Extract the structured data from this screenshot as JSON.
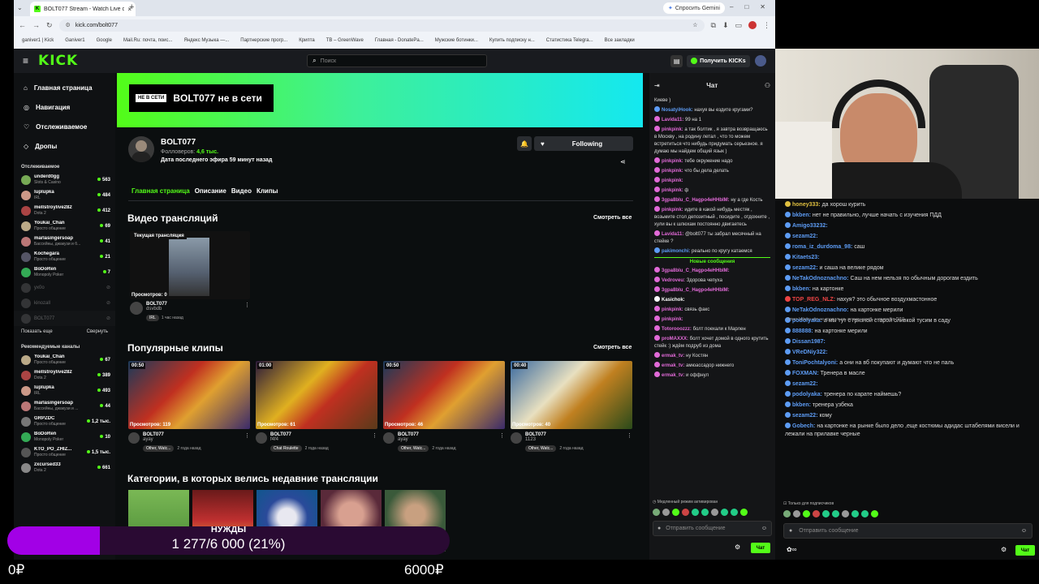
{
  "browser": {
    "tab_title": "BOLT077 Stream - Watch Live o...",
    "new_tab": "+",
    "url": "kick.com/bolt077",
    "gemini": "Спросить Gemini",
    "bookmarks": [
      "ganiver1 | Kick",
      "Ganiver1",
      "Google",
      "Mail.Ru: почта, поис...",
      "Яндекс Музыка —...",
      "Партнерские прогр...",
      "Крипта",
      "TB – GreenWave",
      "Главная - DonatePa...",
      "Мужские ботинки...",
      "Купить подписку н...",
      "Статистика Telegra...",
      "Все закладки"
    ]
  },
  "topnav": {
    "logo": "KICK",
    "search_placeholder": "Поиск",
    "cta": "Получить KICKs"
  },
  "sidebar": {
    "nav": [
      {
        "icon": "home-icon",
        "label": "Главная страница"
      },
      {
        "icon": "compass-icon",
        "label": "Навигация"
      },
      {
        "icon": "heart-icon",
        "label": "Отслеживаемое"
      },
      {
        "icon": "drops-icon",
        "label": "Дропы"
      }
    ],
    "following_title": "Отслеживаемое",
    "following": [
      {
        "name": "underd0gg",
        "sub": "Slots & Casino",
        "viewers": "563",
        "color": "#7a5"
      },
      {
        "name": "luplupka",
        "sub": "IRL",
        "viewers": "484",
        "color": "#c98"
      },
      {
        "name": "mellstroylive282",
        "sub": "Dota 2",
        "viewers": "412",
        "color": "#a44"
      },
      {
        "name": "Youkai_Chan",
        "sub": "Просто общение",
        "viewers": "69",
        "color": "#ba8"
      },
      {
        "name": "marlasingersoap",
        "sub": "Бассейны, джакузи и б...",
        "viewers": "41",
        "color": "#b77"
      },
      {
        "name": "Kochegara",
        "sub": "Просто общение",
        "viewers": "21",
        "color": "#556"
      },
      {
        "name": "BoDoRen",
        "sub": "Monopoly Poker",
        "viewers": "7",
        "color": "#3a5"
      }
    ],
    "offline": [
      "yx0o",
      "kinozall",
      "BOLT077"
    ],
    "show_more": "Показать еще",
    "collapse": "Свернуть",
    "rec_title": "Рекомендуемые каналы",
    "recommended": [
      {
        "name": "Youkai_Chan",
        "sub": "Просто общение",
        "viewers": "67",
        "color": "#ba8"
      },
      {
        "name": "mellstroylive282",
        "sub": "Dota 2",
        "viewers": "389",
        "color": "#a44"
      },
      {
        "name": "luplupka",
        "sub": "IRL",
        "viewers": "493",
        "color": "#c98"
      },
      {
        "name": "marlasingersoap",
        "sub": "Бассейны, джакузи и ...",
        "viewers": "44",
        "color": "#b77"
      },
      {
        "name": "GRPZDC",
        "sub": "Просто общение",
        "viewers": "1,2 тыс.",
        "color": "#777"
      },
      {
        "name": "BoDoRen",
        "sub": "Monopoly Poker",
        "viewers": "10",
        "color": "#3a5"
      },
      {
        "name": "KTO_PO_ZHIZ...",
        "sub": "Просто общение",
        "viewers": "1,5 тыс.",
        "color": "#555"
      },
      {
        "name": "zxcursed33",
        "sub": "Dota 2",
        "viewers": "661",
        "color": "#888"
      }
    ]
  },
  "channel": {
    "offline_tag": "НЕ В СЕТИ",
    "offline_text": "BOLT077 не в сети",
    "name": "BOLT077",
    "followers_label": "Фолловеров:",
    "followers": "4,6 тыс.",
    "last_stream": "Дата последнего эфира 59 минут назад",
    "following_btn": "Following",
    "tabs": [
      "Главная страница",
      "Описание",
      "Видео",
      "Клипы"
    ]
  },
  "videos": {
    "title": "Видео трансляций",
    "see_all": "Смотреть все",
    "item": {
      "badge": "Текущая трансляция",
      "views": "Просмотров: 0",
      "channel": "BOLT077",
      "title": "dsvbdb",
      "tag": "IRL",
      "ago": "1 час назад"
    }
  },
  "clips": {
    "title": "Популярные клипы",
    "see_all": "Смотреть все",
    "items": [
      {
        "dur": "00:50",
        "views": "Просмотров: 119",
        "channel": "BOLT077",
        "title": "ayay",
        "tag": "Other, Watc...",
        "ago": "2 года назад"
      },
      {
        "dur": "01:00",
        "views": "Просмотров: 61",
        "channel": "BOLT077",
        "title": "f4f4",
        "tag": "Chat Roulette",
        "ago": "2 года назад"
      },
      {
        "dur": "00:50",
        "views": "Просмотров: 46",
        "channel": "BOLT077",
        "title": "ayay",
        "tag": "Other, Watc...",
        "ago": "2 года назад"
      },
      {
        "dur": "00:40",
        "views": "Просмотров: 40",
        "channel": "BOLT077",
        "title": "1123",
        "tag": "Other, Watc...",
        "ago": "2 года назад"
      }
    ]
  },
  "categories": {
    "title": "Категории, в которых велись недавние трансляции"
  },
  "chat": {
    "title": "Чат",
    "messages": [
      {
        "u": "",
        "t": "Киеве )",
        "c": "#ddd"
      },
      {
        "u": "NosatyiHook:",
        "t": "нахуя вы ездите кругами?",
        "c": "#5d9cf5"
      },
      {
        "u": "Lavida11:",
        "t": "99 на 1",
        "c": "#e26ad8"
      },
      {
        "u": "pinkpink:",
        "t": "а так болтик , я завтра возвращаюсь в Москву , на родину летал , что то можем встретиться что нибудь придумать серьезное. я думаю мы найдем общий язык )",
        "c": "#e26ad8"
      },
      {
        "u": "pinkpink:",
        "t": "тебе окружение надо",
        "c": "#e26ad8"
      },
      {
        "u": "pinkpink:",
        "t": "что бы дела делать",
        "c": "#e26ad8"
      },
      {
        "u": "pinkpink:",
        "t": "",
        "c": "#e26ad8"
      },
      {
        "u": "pinkpink:",
        "t": "ф",
        "c": "#e26ad8"
      },
      {
        "u": "3gpa8blu_C_Hagpo4eHHbIM:",
        "t": "ну а где Кость",
        "c": "#e26ad8"
      },
      {
        "u": "pinkpink:",
        "t": "идите в какой нибудь местяк , возьмите стол депозитный , посидите , отдохните , хули вы к шлюхам постоянно двигаетесь",
        "c": "#e26ad8"
      },
      {
        "u": "Lavida11:",
        "t": "@bolt077 ты забрал месячный на стейке ?",
        "c": "#e26ad8"
      },
      {
        "u": "pakimonchi:",
        "t": "реально по кругу катаемся",
        "c": "#5d9cf5"
      }
    ],
    "new_messages": "Новые сообщения",
    "messages2": [
      {
        "u": "3gpa8blu_C_Hagpo4eHHbIM:",
        "t": "",
        "c": "#e26ad8"
      },
      {
        "u": "Vedroveu:",
        "t": "Здорова чепуха",
        "c": "#e26ad8"
      },
      {
        "u": "3gpa8blu_C_Hagpo4eHHbIM:",
        "t": "",
        "c": "#e26ad8"
      },
      {
        "u": "Kasichok:",
        "t": "",
        "c": "#fff"
      },
      {
        "u": "pinkpink:",
        "t": "связь факс",
        "c": "#e26ad8"
      },
      {
        "u": "pinkpink:",
        "t": "",
        "c": "#e26ad8"
      },
      {
        "u": "Totorooozzz:",
        "t": "болт поехали к Марлен",
        "c": "#e26ad8"
      },
      {
        "u": "proMAXXX:",
        "t": "болт хочет домой в одного крутить стейк :) ждём подруб из дома",
        "c": "#e26ad8"
      },
      {
        "u": "ermak_tv:",
        "t": "ну Костян",
        "c": "#e26ad8"
      },
      {
        "u": "ermak_tv:",
        "t": "амюассадор нижнего",
        "c": "#e26ad8"
      },
      {
        "u": "ermak_tv:",
        "t": "и оффнул",
        "c": "#e26ad8"
      }
    ],
    "slow_mode": "Медленный режим активирован",
    "input_placeholder": "Отправить сообщение",
    "send": "Чат"
  },
  "rchat": {
    "messages": [
      {
        "u": "honey333:",
        "t": "да хорош курить",
        "c": "#e0c040"
      },
      {
        "u": "bkben:",
        "t": "нет не правильно, лучше начать с изучения ПДД",
        "c": "#5d9cf5"
      },
      {
        "u": "Amigo33232:",
        "t": "",
        "c": "#5d9cf5"
      },
      {
        "u": "sezam22:",
        "t": "",
        "c": "#5d9cf5"
      },
      {
        "u": "roma_iz_durdoma_98:",
        "t": "саш",
        "c": "#5d9cf5"
      },
      {
        "u": "Kitaets23:",
        "t": "",
        "c": "#5d9cf5"
      },
      {
        "u": "sezam22:",
        "t": "и саша на велике рядом",
        "c": "#5d9cf5"
      },
      {
        "u": "NeTakOdnoznachno:",
        "t": "Саш на нем нельзя по обычным дорогам ездить",
        "c": "#5d9cf5"
      },
      {
        "u": "bkben:",
        "t": "на картонке",
        "c": "#5d9cf5"
      },
      {
        "u": "TOP_REG_NLZ:",
        "t": "нахуя? это обычное воздухмастонное",
        "c": "#ee4444"
      },
      {
        "u": "NeTakOdnoznachno:",
        "t": "на картонке мерили",
        "c": "#5d9cf5"
      },
      {
        "u": "podolyaka:",
        "t": "а мы тут с грязной старой оливкой тусим в саду",
        "c": "#5d9cf5"
      },
      {
        "u": "888888:",
        "t": "на картонке мерили",
        "c": "#5d9cf5"
      },
      {
        "u": "Dissan1987:",
        "t": "",
        "c": "#5d9cf5"
      },
      {
        "u": "VReDNiy322:",
        "t": "",
        "c": "#5d9cf5"
      },
      {
        "u": "ToniPochtalyoni:",
        "t": "а они на вб покупают и думают что не паль",
        "c": "#5d9cf5"
      },
      {
        "u": "FOXMAN:",
        "t": "Тренера в масле",
        "c": "#5d9cf5"
      },
      {
        "u": "sezam22:",
        "t": "",
        "c": "#5d9cf5"
      },
      {
        "u": "podolyaka:",
        "t": "тренера по карате наймешь?",
        "c": "#5d9cf5"
      },
      {
        "u": "bkben:",
        "t": "тренера узбека",
        "c": "#5d9cf5"
      },
      {
        "u": "sezam22:",
        "t": "кому",
        "c": "#5d9cf5"
      },
      {
        "u": "Gobech:",
        "t": "на картонке на рынке было дело ,еще костюмы адидас штабелями висели и лежали на прилавке черные",
        "c": "#5d9cf5"
      }
    ],
    "subs_only": "Только для подписчиков",
    "input_placeholder": "Отправить сообщение",
    "send": "Чат",
    "reply_hint": "Ответ bkben: нет не правильно, лучше начать с изучения ПДД"
  },
  "donation": {
    "label": "НУЖДЫ",
    "progress_text": "1 277/6 000 (21%)",
    "progress": 0.21,
    "min": "0₽",
    "max": "6000₽",
    "fill_color": "#a200e6"
  }
}
